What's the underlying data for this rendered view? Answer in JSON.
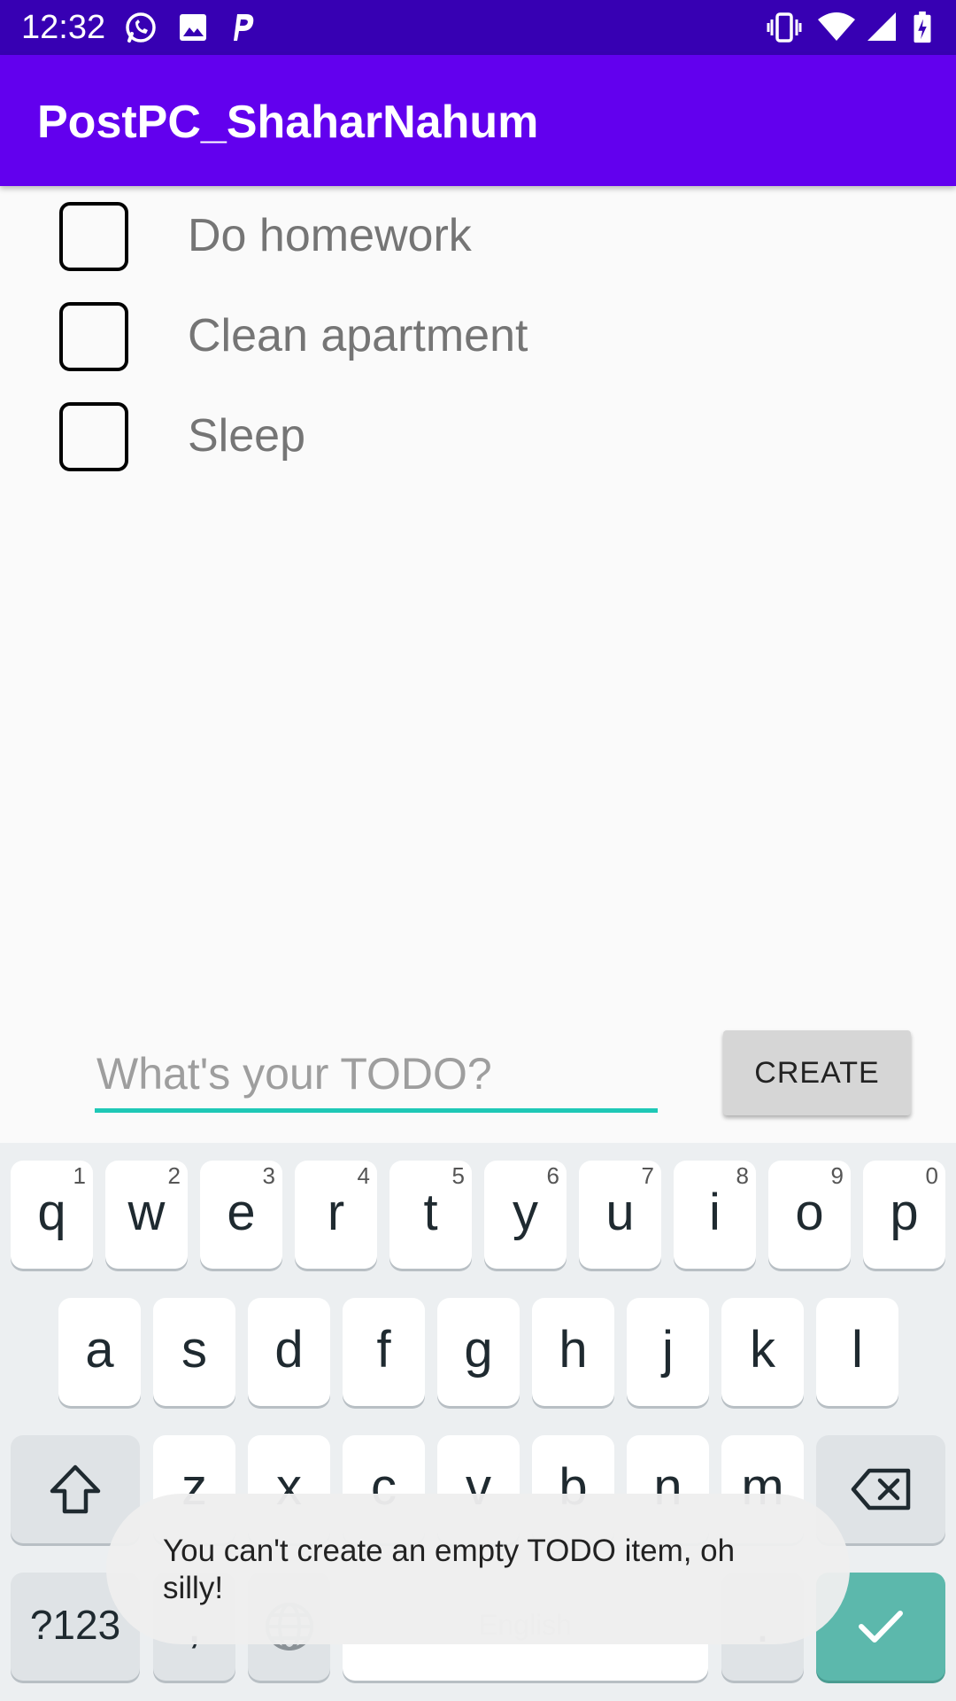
{
  "status_bar": {
    "time": "12:32",
    "left_icons": [
      "whatsapp-icon",
      "image-icon",
      "p-app-icon"
    ],
    "right_icons": [
      "vibrate-icon",
      "wifi-icon",
      "signal-icon",
      "battery-icon"
    ]
  },
  "app_bar": {
    "title": "PostPC_ShaharNahum"
  },
  "todos": [
    {
      "text": "Do homework",
      "checked": false
    },
    {
      "text": "Clean apartment",
      "checked": false
    },
    {
      "text": "Sleep",
      "checked": false
    }
  ],
  "input": {
    "placeholder": "What's your TODO?",
    "value": ""
  },
  "create_button": {
    "label": "CREATE"
  },
  "keyboard": {
    "row1": [
      {
        "k": "q",
        "h": "1"
      },
      {
        "k": "w",
        "h": "2"
      },
      {
        "k": "e",
        "h": "3"
      },
      {
        "k": "r",
        "h": "4"
      },
      {
        "k": "t",
        "h": "5"
      },
      {
        "k": "y",
        "h": "6"
      },
      {
        "k": "u",
        "h": "7"
      },
      {
        "k": "i",
        "h": "8"
      },
      {
        "k": "o",
        "h": "9"
      },
      {
        "k": "p",
        "h": "0"
      }
    ],
    "row2": [
      "a",
      "s",
      "d",
      "f",
      "g",
      "h",
      "j",
      "k",
      "l"
    ],
    "row3": [
      "z",
      "x",
      "c",
      "v",
      "b",
      "n",
      "m"
    ],
    "symbols_label": "?123",
    "comma_label": ",",
    "space_label": "English",
    "period_label": "."
  },
  "toast": {
    "message": "You can't create an empty TODO item, oh silly!"
  },
  "colors": {
    "status_bar": "#3700b3",
    "app_bar": "#6200ee",
    "input_underline": "#1ec8b6",
    "enter_key": "#5cb8ac"
  }
}
